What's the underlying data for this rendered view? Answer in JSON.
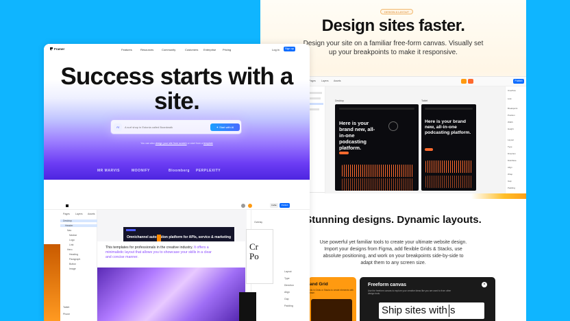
{
  "right_panel": {
    "badge": "DESIGN & LAYOUT",
    "title": "Design sites faster.",
    "subtitle": "Design your site on a familiar free-form canvas. Visually set up your breakpoints to make it responsive.",
    "editor": {
      "toolbar_tabs": [
        "Pages",
        "Layers",
        "Assets"
      ],
      "share_button": "Publish",
      "frames": [
        {
          "label": "Desktop",
          "headline": "Here is your brand new, all-in-one podcasting platform."
        },
        {
          "label": "Tablet",
          "headline": "Here is your brand new, all-in-one podcasting platform."
        }
      ],
      "properties": [
        "Overflow",
        "Link",
        "Breakpoint",
        "Position",
        "Width",
        "Height",
        "Layout",
        "Type",
        "Direction",
        "Distribute",
        "Align",
        "Wrap",
        "Gap",
        "Padding"
      ]
    },
    "section2_title": "Stunning designs. Dynamic layouts.",
    "section2_text": "Use powerful yet familiar tools to create your ultimate website design. Import your designs from Figma, add flexible Grids & Stacks, use absolute positioning, and work on your breakpoints side-by-side to adapt them to any screen size.",
    "card_left_title": "and Grid",
    "card_left_desc": "nts in Grids or Stacks to create elements with ease.",
    "card_right_title": "Freeform canvas",
    "card_right_desc": "Use the freeform canvas to explore your creative ideas like you are used to from other design tools.",
    "ship_text": "Ship sites with s"
  },
  "left_panel": {
    "brand": "Framer",
    "nav": [
      "Features",
      "Resources",
      "Community",
      "Customers",
      "Enterprise",
      "Pricing"
    ],
    "login": "Log in",
    "signup": "Sign up",
    "headline": "Success starts with a site.",
    "prompt_icon": "AI",
    "prompt_placeholder": "A surf shop in Estonia called Boardwalk",
    "start_button": "Start with AI",
    "hint_prefix": "You can also",
    "hint_link": "design your site from scratch",
    "hint_mid": "or start from a",
    "hint_link2": "template",
    "logos": [
      "MR MARVIS",
      "MOONIFY",
      "PERPLEXITY",
      "Bloomberg"
    ],
    "editor": {
      "tabs": [
        "Pages",
        "Layers",
        "Assets"
      ],
      "layers": [
        "Desktop",
        "Header",
        "Nav",
        "Navbar",
        "Logo",
        "Link",
        "Hero",
        "Heading",
        "Paragraph",
        "Button",
        "Image",
        "Tablet",
        "Phone"
      ],
      "site_headline": "Omnichannel automation platform for APIs, service & marketing",
      "template_text_1": "This templates for professionals in the creative industry.",
      "template_text_2": "It offers a minimalistic layout that allows you to showcase your skills in a clear and concise manner.",
      "right_props": [
        "Overlay",
        "Breakpoint",
        "Position",
        "Width",
        "Height",
        "Layout",
        "Type",
        "Direction",
        "Align",
        "Gap",
        "Padding"
      ],
      "publish": "Publish",
      "share": "Invite"
    }
  },
  "colors": {
    "background": "#0fb5ff",
    "accent_blue": "#0d6cff",
    "accent_orange": "#ff9a10",
    "hero_purple": "#6c3cf4"
  }
}
